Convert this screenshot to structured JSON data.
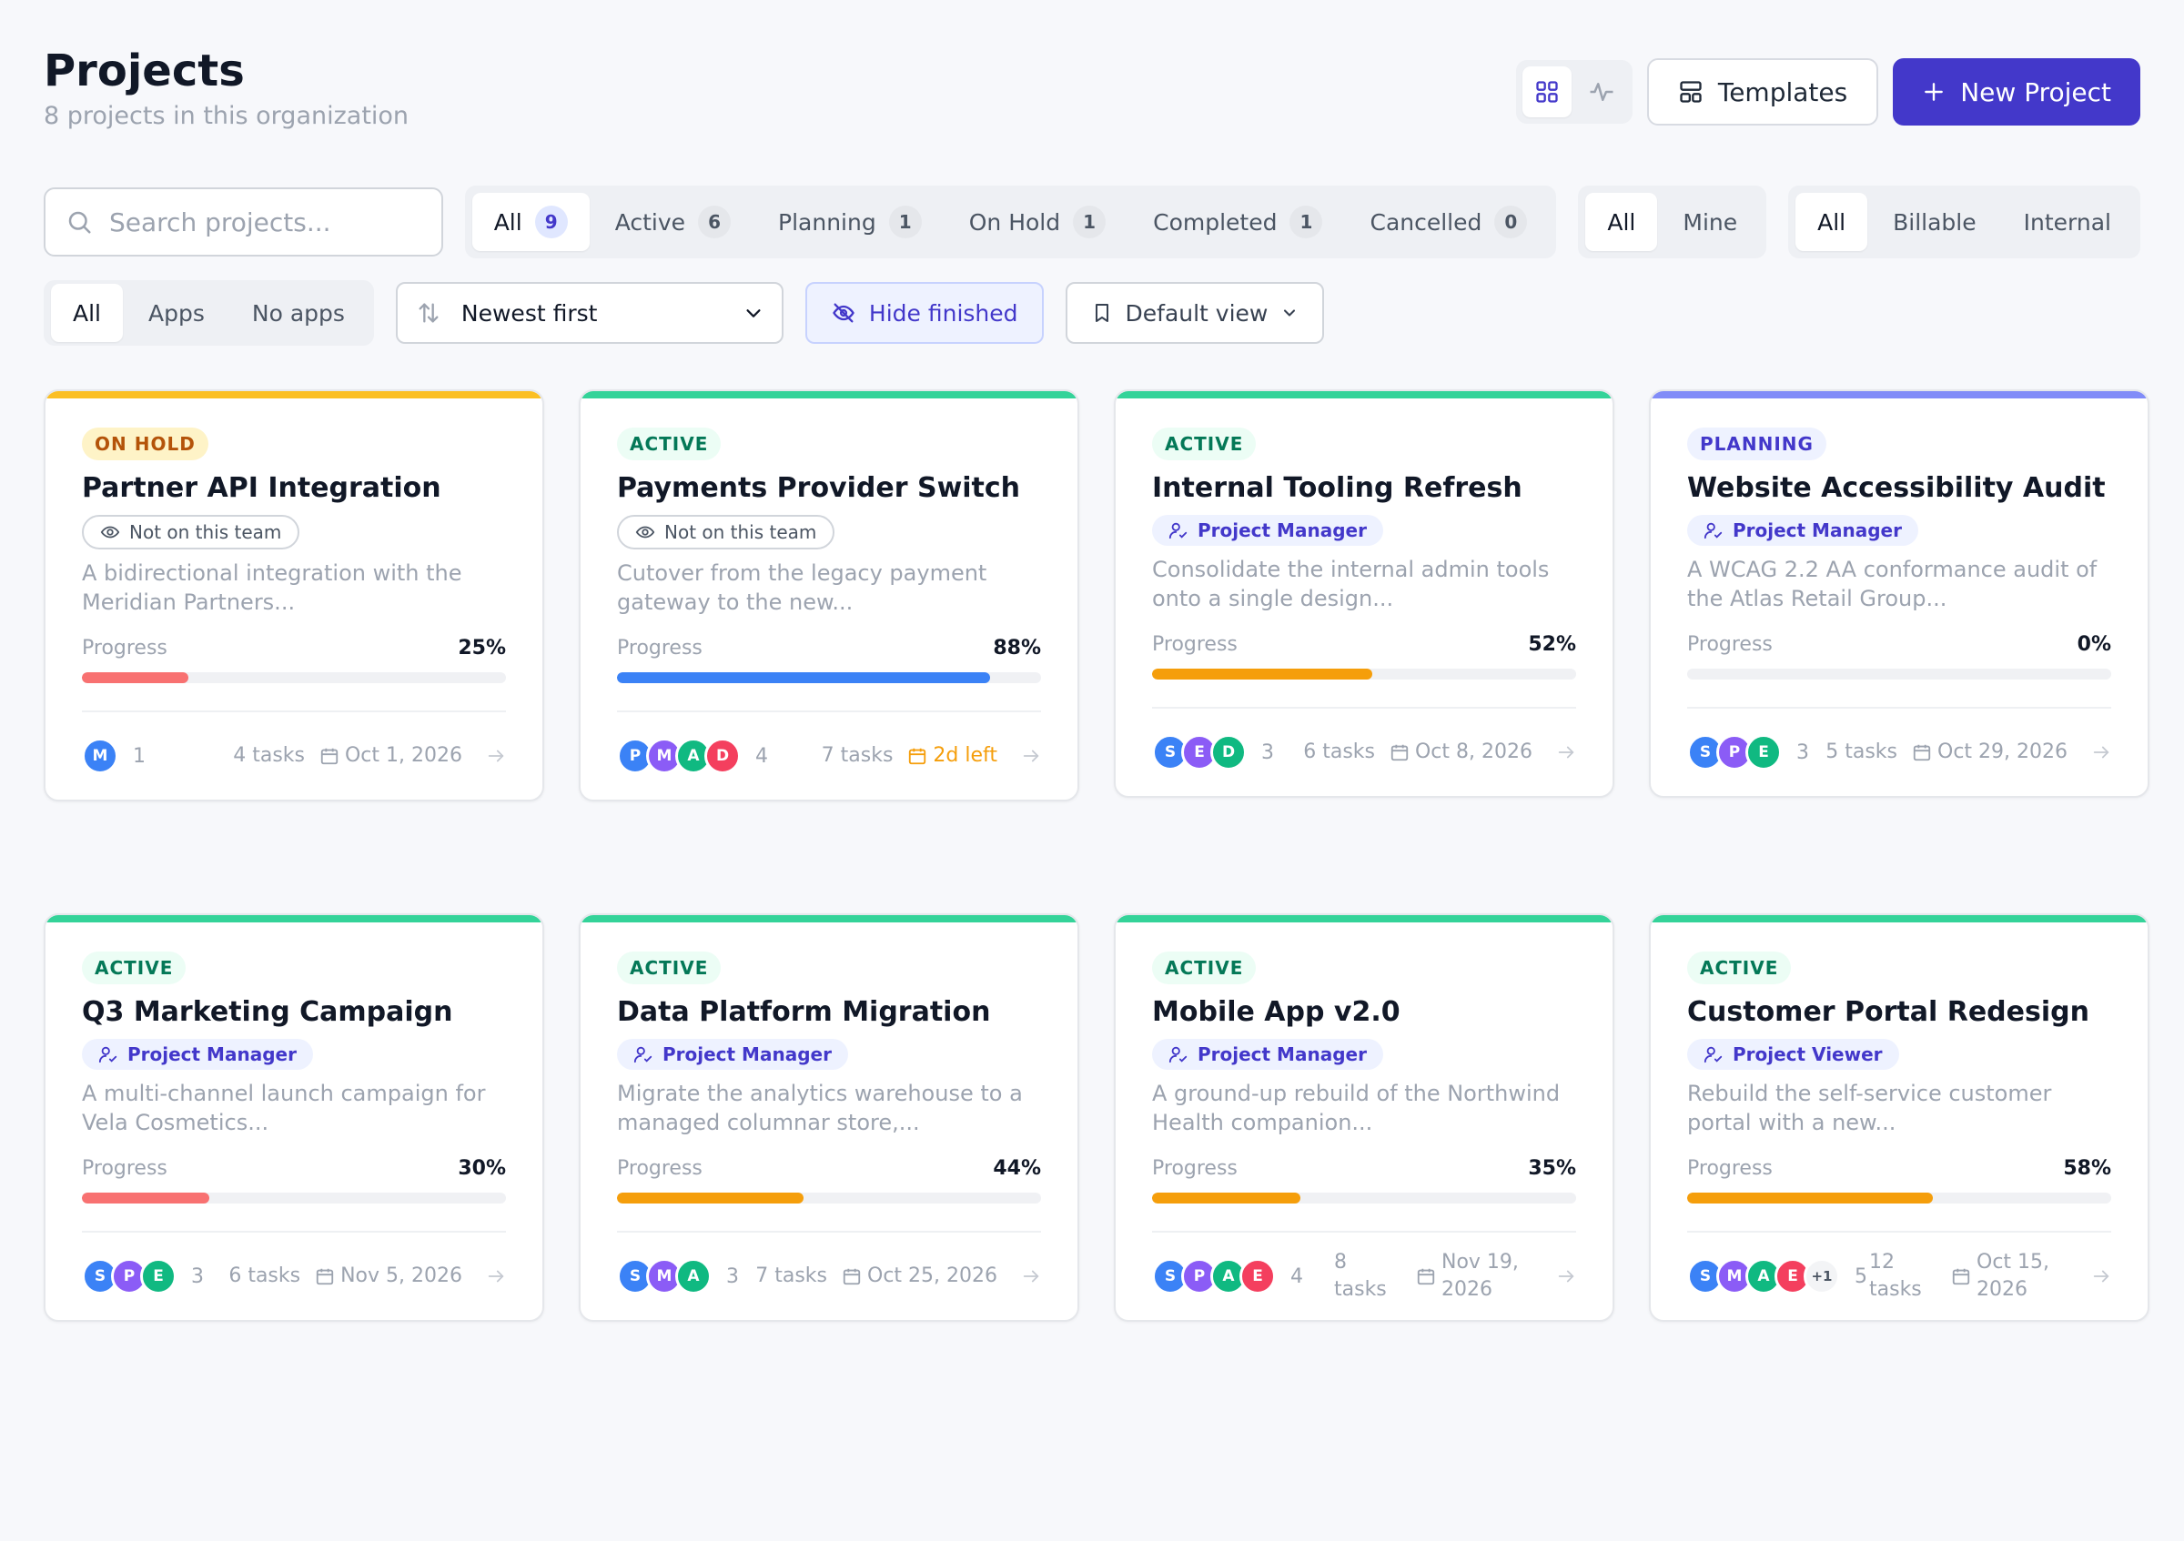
{
  "header": {
    "title": "Projects",
    "subtitle": "8 projects in this organization",
    "templates_label": "Templates",
    "new_project_label": "New Project"
  },
  "search": {
    "placeholder": "Search projects...",
    "value": ""
  },
  "status_filter": [
    {
      "label": "All",
      "count": "9",
      "active": true
    },
    {
      "label": "Active",
      "count": "6",
      "active": false
    },
    {
      "label": "Planning",
      "count": "1",
      "active": false
    },
    {
      "label": "On Hold",
      "count": "1",
      "active": false
    },
    {
      "label": "Completed",
      "count": "1",
      "active": false
    },
    {
      "label": "Cancelled",
      "count": "0",
      "active": false
    }
  ],
  "ownership_filter": [
    {
      "label": "All",
      "active": true
    },
    {
      "label": "Mine",
      "active": false
    }
  ],
  "billing_filter": [
    {
      "label": "All",
      "active": true
    },
    {
      "label": "Billable",
      "active": false
    },
    {
      "label": "Internal",
      "active": false
    }
  ],
  "apps_filter": [
    {
      "label": "All",
      "active": true
    },
    {
      "label": "Apps",
      "active": false
    },
    {
      "label": "No apps",
      "active": false
    }
  ],
  "sort": {
    "selected": "Newest first"
  },
  "hide_finished_label": "Hide finished",
  "default_view_label": "Default view",
  "progress_label": "Progress",
  "colors": {
    "accent": "#4338ca",
    "on_hold": "#fbbf24",
    "active": "#34d399",
    "planning": "#818cf8",
    "progress_red": "#f87171",
    "progress_blue": "#3b82f6",
    "progress_orange": "#f59e0b"
  },
  "projects": [
    {
      "status": "ON HOLD",
      "title": "Partner API Integration",
      "chip": "Not on this team",
      "chip_type": "team",
      "description": "A bidirectional integration with the Meridian Partners...",
      "progress": "25%",
      "avatars": [
        "M"
      ],
      "members": "1",
      "tasks": "4 tasks",
      "date": "Oct 1, 2026"
    },
    {
      "status": "ACTIVE",
      "title": "Payments Provider Switch",
      "chip": "Not on this team",
      "chip_type": "team",
      "description": "Cutover from the legacy payment gateway to the new...",
      "progress": "88%",
      "avatars": [
        "P",
        "M",
        "A",
        "D"
      ],
      "members": "4",
      "tasks": "7 tasks",
      "date": "2d left"
    },
    {
      "status": "ACTIVE",
      "title": "Internal Tooling Refresh",
      "chip": "Project Manager",
      "chip_type": "role",
      "description": "Consolidate the internal admin tools onto a single design...",
      "progress": "52%",
      "avatars": [
        "S",
        "E",
        "D"
      ],
      "members": "3",
      "tasks": "6 tasks",
      "date": "Oct 8, 2026"
    },
    {
      "status": "PLANNING",
      "title": "Website Accessibility Audit",
      "chip": "Project Manager",
      "chip_type": "role",
      "description": "A WCAG 2.2 AA conformance audit of the Atlas Retail Group...",
      "progress": "0%",
      "avatars": [
        "S",
        "P",
        "E"
      ],
      "members": "3",
      "tasks": "5 tasks",
      "date": "Oct 29, 2026"
    },
    {
      "status": "ACTIVE",
      "title": "Q3 Marketing Campaign",
      "chip": "Project Manager",
      "chip_type": "role",
      "description": "A multi-channel launch campaign for Vela Cosmetics...",
      "progress": "30%",
      "avatars": [
        "S",
        "P",
        "E"
      ],
      "members": "3",
      "tasks": "6 tasks",
      "date": "Nov 5, 2026"
    },
    {
      "status": "ACTIVE",
      "title": "Data Platform Migration",
      "chip": "Project Manager",
      "chip_type": "role",
      "description": "Migrate the analytics warehouse to a managed columnar store,...",
      "progress": "44%",
      "avatars": [
        "S",
        "M",
        "A"
      ],
      "members": "3",
      "tasks": "7 tasks",
      "date": "Oct 25, 2026"
    },
    {
      "status": "ACTIVE",
      "title": "Mobile App v2.0",
      "chip": "Project Manager",
      "chip_type": "role",
      "description": "A ground-up rebuild of the Northwind Health companion...",
      "progress": "35%",
      "avatars": [
        "S",
        "P",
        "A",
        "E"
      ],
      "members": "4",
      "tasks": "8 tasks",
      "date": "Nov 19, 2026"
    },
    {
      "status": "ACTIVE",
      "title": "Customer Portal Redesign",
      "chip": "Project Viewer",
      "chip_type": "role",
      "description": "Rebuild the self-service customer portal with a new...",
      "progress": "58%",
      "avatars": [
        "S",
        "M",
        "A",
        "E"
      ],
      "avatars_more": "+1",
      "members": "5",
      "tasks": "12 tasks",
      "date": "Oct 15, 2026"
    }
  ]
}
